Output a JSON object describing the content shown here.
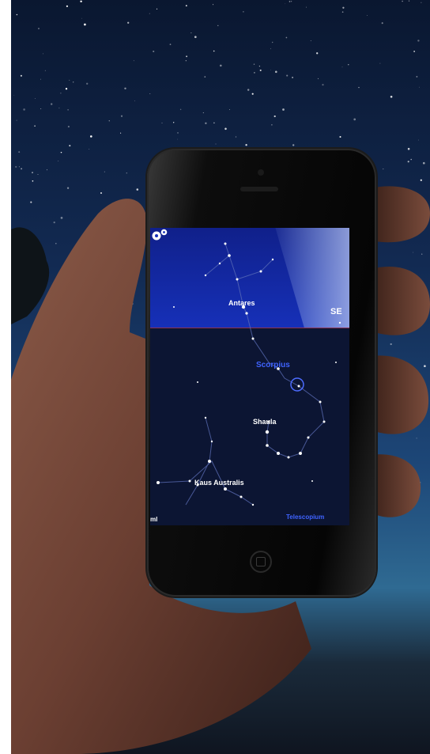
{
  "screen": {
    "star_labels": {
      "antares": "Antares",
      "shaula": "Shaula",
      "kaus_australis": "Kaus Australis"
    },
    "constellation_labels": {
      "scorpius": "Scorpius",
      "telescopium": "Telescopium"
    },
    "direction": "SE",
    "edge_label": "ml"
  },
  "icons": {
    "settings": "gear-icon",
    "home_button": "home-button-icon"
  },
  "colors": {
    "upper_sky": "#1630b8",
    "lower_sky": "#0c1533",
    "label_blue": "#3f63ff",
    "horizon_line": "#c24060"
  }
}
